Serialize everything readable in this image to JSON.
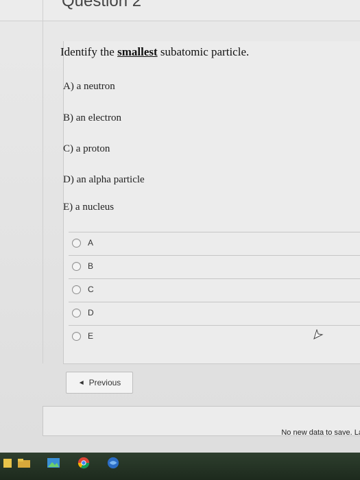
{
  "header": {
    "title": "Question 2"
  },
  "question": {
    "prompt_before": "Identify the ",
    "prompt_emphasis": "smallest",
    "prompt_after": " subatomic particle.",
    "choices": [
      "A) a neutron",
      "B) an electron",
      "C) a proton",
      "D) an alpha particle",
      "E) a nucleus"
    ]
  },
  "answers": {
    "options": [
      "A",
      "B",
      "C",
      "D",
      "E"
    ],
    "selected": null
  },
  "nav": {
    "previous_label": "Previous"
  },
  "status": {
    "message": "No new data to save. La"
  },
  "colors": {
    "page_bg": "#e6e6e6",
    "taskbar": "#1d2a1d"
  },
  "taskbar_icons": [
    "file-explorer-icon",
    "photos-icon",
    "chrome-icon",
    "browser-icon"
  ]
}
